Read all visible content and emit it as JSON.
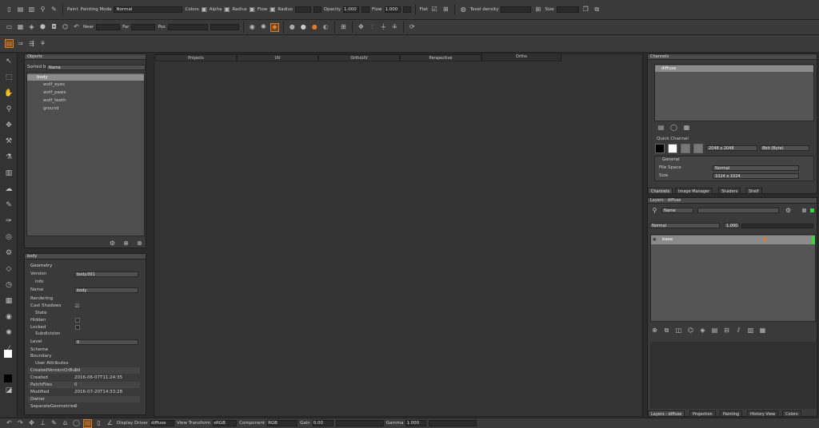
{
  "toolbar1": {
    "paint": "Paint",
    "painting_mode_label": "Painting Mode",
    "painting_mode_value": "Normal",
    "colors": "Colors",
    "alpha": "Alpha",
    "radius": "Radius",
    "flow": "Flow",
    "radius2": "Radius",
    "opacity": "Opacity",
    "opacity_value": "1.000",
    "flow2": "Flow",
    "flow2_value": "1.000",
    "flat": "Flat",
    "texel_density": "Texel density",
    "size": "Size"
  },
  "toolbar2": {
    "near": "Near",
    "far": "Far",
    "pos": "Pos"
  },
  "tabs": [
    "Projects",
    "UV",
    "OrthoUV",
    "Perspective",
    "Ortho"
  ],
  "objects": {
    "title": "Objects",
    "sorted_by": "Sorted by",
    "sorted_value": "Name",
    "items": [
      "body",
      "wolf_eyes",
      "wolf_paws",
      "wolf_teeth",
      "ground"
    ]
  },
  "props": {
    "title": "body",
    "geometry": "Geometry",
    "version": "Version",
    "version_value": "body.001",
    "info": "Info",
    "name": "Name",
    "name_value": "body",
    "rendering": "Rendering",
    "cast_shadows": "Cast Shadows",
    "state": "State",
    "hidden": "Hidden",
    "locked": "Locked",
    "subdivision": "Subdivision",
    "level": "Level",
    "level_value": "0",
    "scheme": "Scheme",
    "boundary": "Boundary",
    "user_attributes": "User Attributes",
    "attrs": [
      {
        "k": "CreatedVersionOrBuild",
        "v": "1"
      },
      {
        "k": "Created",
        "v": "2016-06-07T11:24:35"
      },
      {
        "k": "PatchFiles",
        "v": "0"
      },
      {
        "k": "Modified",
        "v": "2016-07-20T14:33:28"
      },
      {
        "k": "Owner",
        "v": ""
      },
      {
        "k": "SeparateGeometries",
        "v": "0"
      }
    ]
  },
  "channels": {
    "title": "Channels",
    "item": "diffuse",
    "quick_channel": "Quick Channel",
    "res1": "2048 x 2048",
    "bit_depth": "8bit (Byte)",
    "general": "General",
    "file_space": "File Space",
    "file_space_value": "Normal",
    "size": "Size",
    "size_value": "1024 x 1024",
    "tabs": [
      "Channels",
      "Image Manager",
      "Shaders",
      "Shelf"
    ]
  },
  "layers": {
    "title": "Layers - diffuse",
    "filter": "Name",
    "blend": "Normal",
    "opacity": "1.000",
    "layer_name": "base",
    "tabs": [
      "Layers - diffuse",
      "Projection",
      "Painting",
      "History View",
      "Colors"
    ]
  },
  "status": {
    "display_driver": "Display Driver",
    "display_driver_value": "diffuse",
    "view_transform": "View Transform",
    "view_transform_value": "sRGB",
    "component": "Component",
    "component_value": "RGB",
    "gain": "Gain",
    "gain_value": "0.00",
    "gamma": "Gamma",
    "gamma_value": "1.000"
  }
}
